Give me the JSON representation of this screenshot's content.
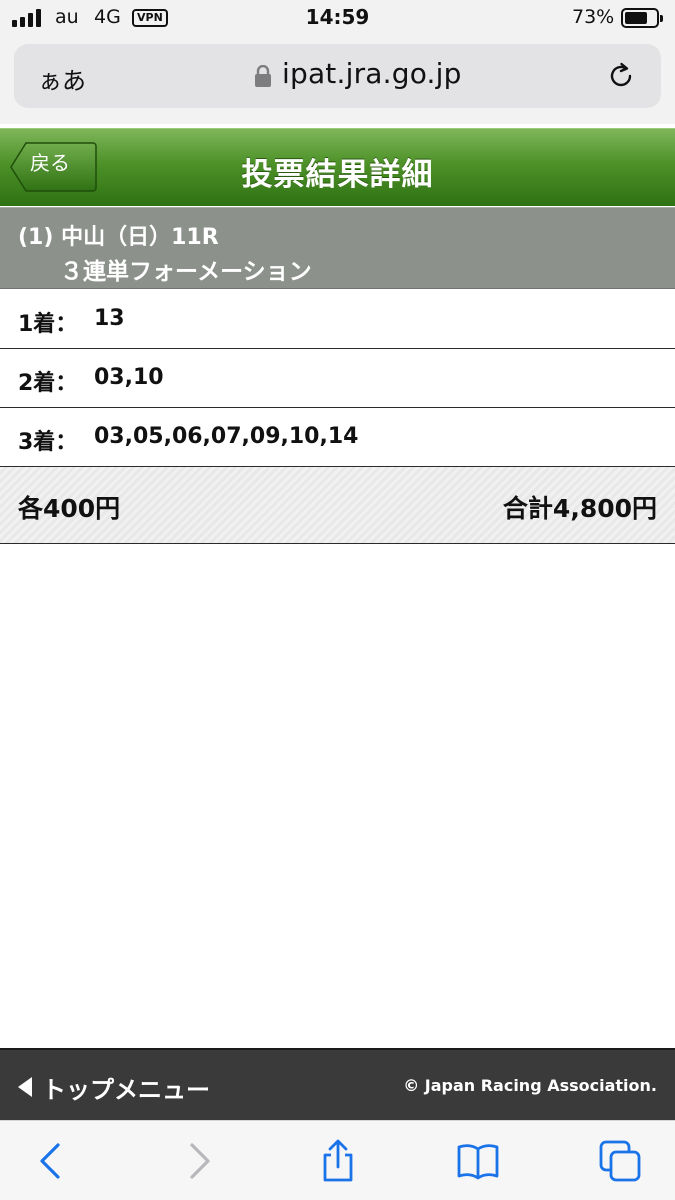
{
  "status_bar": {
    "carrier": "au",
    "network": "4G",
    "vpn": "VPN",
    "time": "14:59",
    "battery_percent_label": "73%",
    "battery_level": 0.73,
    "signal_bars": 4
  },
  "browser": {
    "aa_label": "ぁあ",
    "url": "ipat.jra.go.jp",
    "icons": [
      "lock-icon",
      "reload-icon"
    ]
  },
  "header": {
    "back_label": "戻る",
    "title": "投票結果詳細"
  },
  "race": {
    "line": "(1) 中山（日）11R",
    "bet_type": "３連単フォーメーション"
  },
  "selections": [
    {
      "label": "1着：",
      "numbers": "13"
    },
    {
      "label": "2着：",
      "numbers": "03,10"
    },
    {
      "label": "3着：",
      "numbers": "03,05,06,07,09,10,14"
    }
  ],
  "totals": {
    "unit_amount": "各400円",
    "total_amount": "合計4,800円"
  },
  "footer": {
    "top_menu_label": "トップメニュー",
    "copyright": "© Japan Racing Association."
  },
  "toolbar": {
    "icons": [
      "back-arrow-icon",
      "forward-arrow-icon",
      "share-icon",
      "bookmarks-icon",
      "tabs-icon"
    ]
  },
  "colors": {
    "header_green": "#4d9128",
    "race_info_gray": "#8d918c",
    "footer_dark": "#3a3a3a",
    "toolbar_blue": "#1a73e8"
  }
}
